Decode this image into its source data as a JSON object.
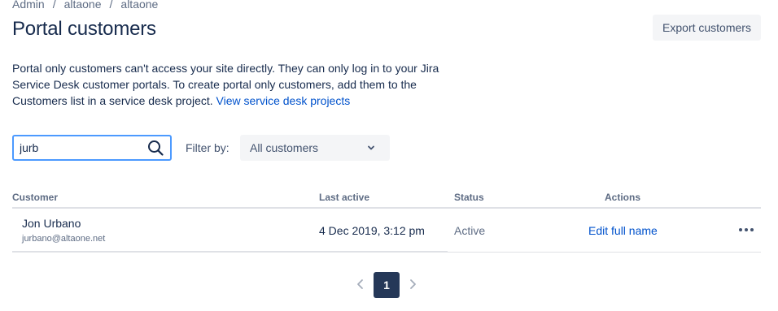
{
  "breadcrumb": [
    "Admin",
    "altaone",
    "altaone"
  ],
  "page_title": "Portal customers",
  "export_label": "Export customers",
  "description": {
    "text": "Portal only customers can't access your site directly. They can only log in to your Jira Service Desk customer portals. To create portal only customers, add them to the Customers list in a service desk project. ",
    "link": "View service desk projects"
  },
  "search": {
    "value": "jurb",
    "placeholder": ""
  },
  "filter": {
    "label": "Filter by:",
    "selected": "All customers"
  },
  "table": {
    "headers": {
      "customer": "Customer",
      "last_active": "Last active",
      "status": "Status",
      "actions": "Actions"
    },
    "rows": [
      {
        "name": "Jon Urbano",
        "email": "jurbano@altaone.net",
        "last_active": "4 Dec 2019, 3:12 pm",
        "status": "Active",
        "action": "Edit full name"
      }
    ]
  },
  "pagination": {
    "current": "1"
  },
  "icons": {
    "search": "search-icon",
    "dropdown": "chevron-down-icon",
    "more": "more-icon",
    "prev": "chevron-left-icon",
    "next": "chevron-right-icon"
  },
  "colors": {
    "link": "#0052cc",
    "focus": "#4c9aff",
    "page_active": "#253858"
  }
}
